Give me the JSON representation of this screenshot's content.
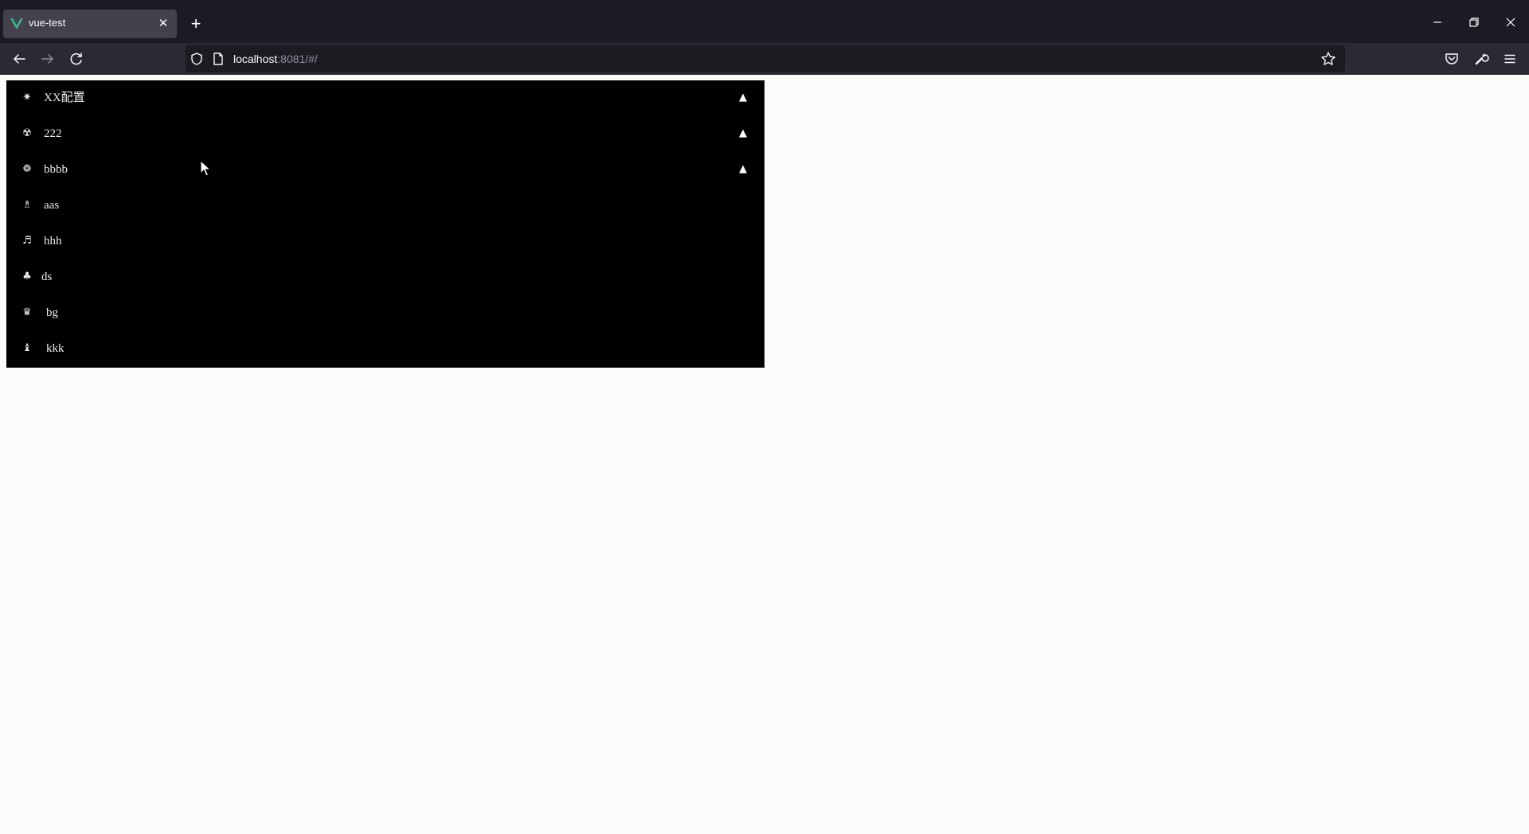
{
  "browser": {
    "tab": {
      "title": "vue-test",
      "logo_icon": "vue-logo-icon",
      "close_icon": "close-icon"
    },
    "new_tab_icon": "plus-icon",
    "window_controls": [
      "minimize-icon",
      "restore-icon",
      "close-icon"
    ],
    "nav": {
      "back_icon": "arrow-left-icon",
      "forward_icon": "arrow-right-icon",
      "reload_icon": "reload-icon"
    },
    "url": {
      "host": "localhost",
      "rest": ":8081/#/"
    },
    "toolbar_icons": [
      "pocket-icon",
      "wrench-icon",
      "hamburger-menu-icon"
    ]
  },
  "menu": {
    "background": "#000000",
    "items": [
      {
        "label": "XX配置",
        "icon": "✷",
        "icon_name": "sun-icon",
        "expandable": true,
        "caret": "▲"
      },
      {
        "label": "222",
        "icon": "☢",
        "icon_name": "radioactive-icon",
        "expandable": true,
        "caret": "▲"
      },
      {
        "label": "bbbb",
        "icon": "❁",
        "icon_name": "flower-icon",
        "expandable": true,
        "caret": "▲"
      },
      {
        "label": "aas",
        "icon": "♗",
        "icon_name": "chess-bishop-icon",
        "expandable": false
      },
      {
        "label": "hhh",
        "icon": "♬",
        "icon_name": "music-note-icon",
        "expandable": false
      },
      {
        "label": "ds",
        "icon": "♣",
        "icon_name": "club-icon",
        "expandable": false
      },
      {
        "label": "bg",
        "icon": "♛",
        "icon_name": "chess-queen-icon",
        "expandable": false
      },
      {
        "label": "kkk",
        "icon": "♝",
        "icon_name": "chess-bishop-filled-icon",
        "expandable": false
      }
    ]
  }
}
